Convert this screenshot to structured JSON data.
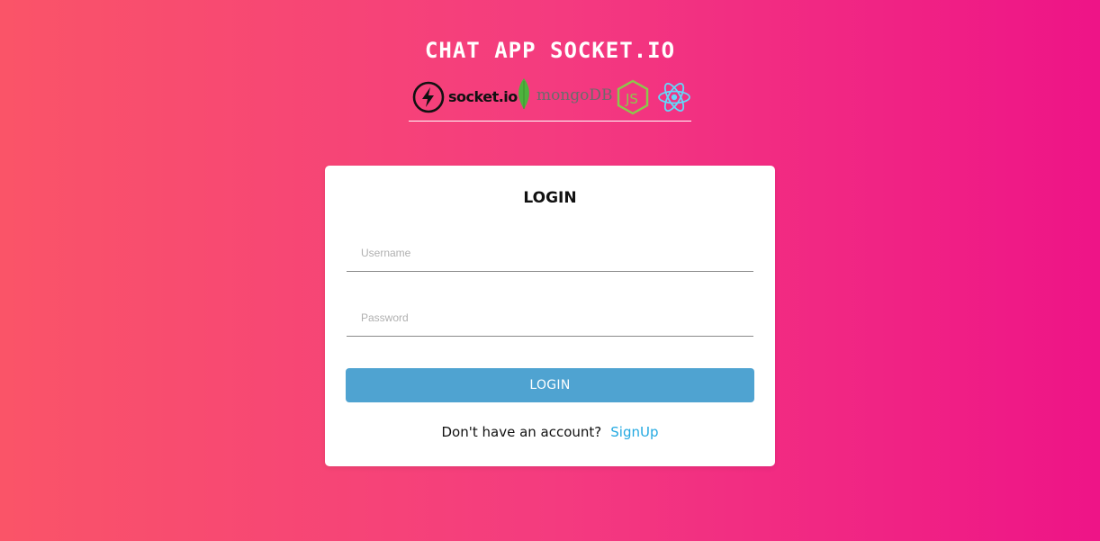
{
  "header": {
    "title": "CHAT APP SOCKET.IO",
    "logos": [
      {
        "icon": "socketio-logo-icon",
        "text": "socket.io"
      },
      {
        "icon": "mongodb-logo-icon",
        "text": "mongoDB"
      },
      {
        "icon": "nodejs-logo-icon"
      },
      {
        "icon": "react-logo-icon"
      }
    ]
  },
  "login": {
    "title": "LOGIN",
    "username_placeholder": "Username",
    "password_placeholder": "Password",
    "button_label": "LOGIN",
    "signup_prompt": "Don't have an account?",
    "signup_link": "SignUp"
  },
  "colors": {
    "gradient_start": "#fa5468",
    "gradient_end": "#ee1487",
    "button": "#4fa3d1",
    "link": "#23a9e1",
    "mongo_leaf": "#4db33d",
    "node_green": "#8cc84b",
    "react_blue": "#61dafb"
  }
}
